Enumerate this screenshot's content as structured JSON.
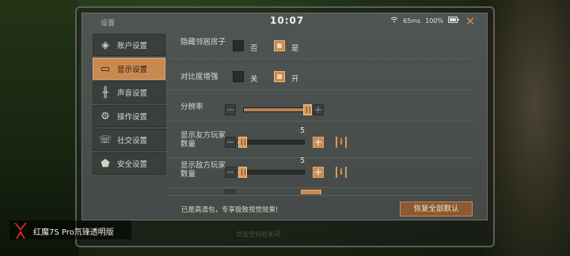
{
  "status": {
    "title": "设置",
    "time": "10:07",
    "ping": "65ms",
    "battery": "100%"
  },
  "sidebar": {
    "items": [
      {
        "label": "账户设置",
        "icon": "account-icon",
        "active": false
      },
      {
        "label": "显示设置",
        "icon": "display-icon",
        "active": true
      },
      {
        "label": "声音设置",
        "icon": "sound-icon",
        "active": false
      },
      {
        "label": "操作设置",
        "icon": "controls-icon",
        "active": false
      },
      {
        "label": "社交设置",
        "icon": "social-icon",
        "active": false
      },
      {
        "label": "安全设置",
        "icon": "security-icon",
        "active": false
      }
    ]
  },
  "settings": {
    "hide_neighbor_house": {
      "label": "隐藏邻居房子",
      "option_no": "否",
      "option_yes": "是",
      "selected": "是"
    },
    "contrast_boost": {
      "label": "对比度增强",
      "option_off": "关",
      "option_on": "开",
      "selected": "开"
    },
    "resolution": {
      "label": "分辨率",
      "minus": "−",
      "plus": "+",
      "value_fraction": 0.95
    },
    "show_friend_players": {
      "label": "显示友方玩家数量",
      "minus": "−",
      "plus": "+",
      "value": "5",
      "value_fraction": 0.08,
      "info": "i"
    },
    "show_enemy_players": {
      "label": "显示敌方玩家数量",
      "minus": "−",
      "plus": "+",
      "value": "5",
      "value_fraction": 0.08,
      "info": "i"
    }
  },
  "footer": {
    "message": "已是高清包，专享极致视觉效果!",
    "reset_label": "恢复全部默认",
    "hint": "点击空白处关闭"
  },
  "branding": {
    "text": "红魔7S Pro氘锋透明版"
  },
  "colors": {
    "accent": "#c98a52",
    "panel": "#4f5552"
  }
}
